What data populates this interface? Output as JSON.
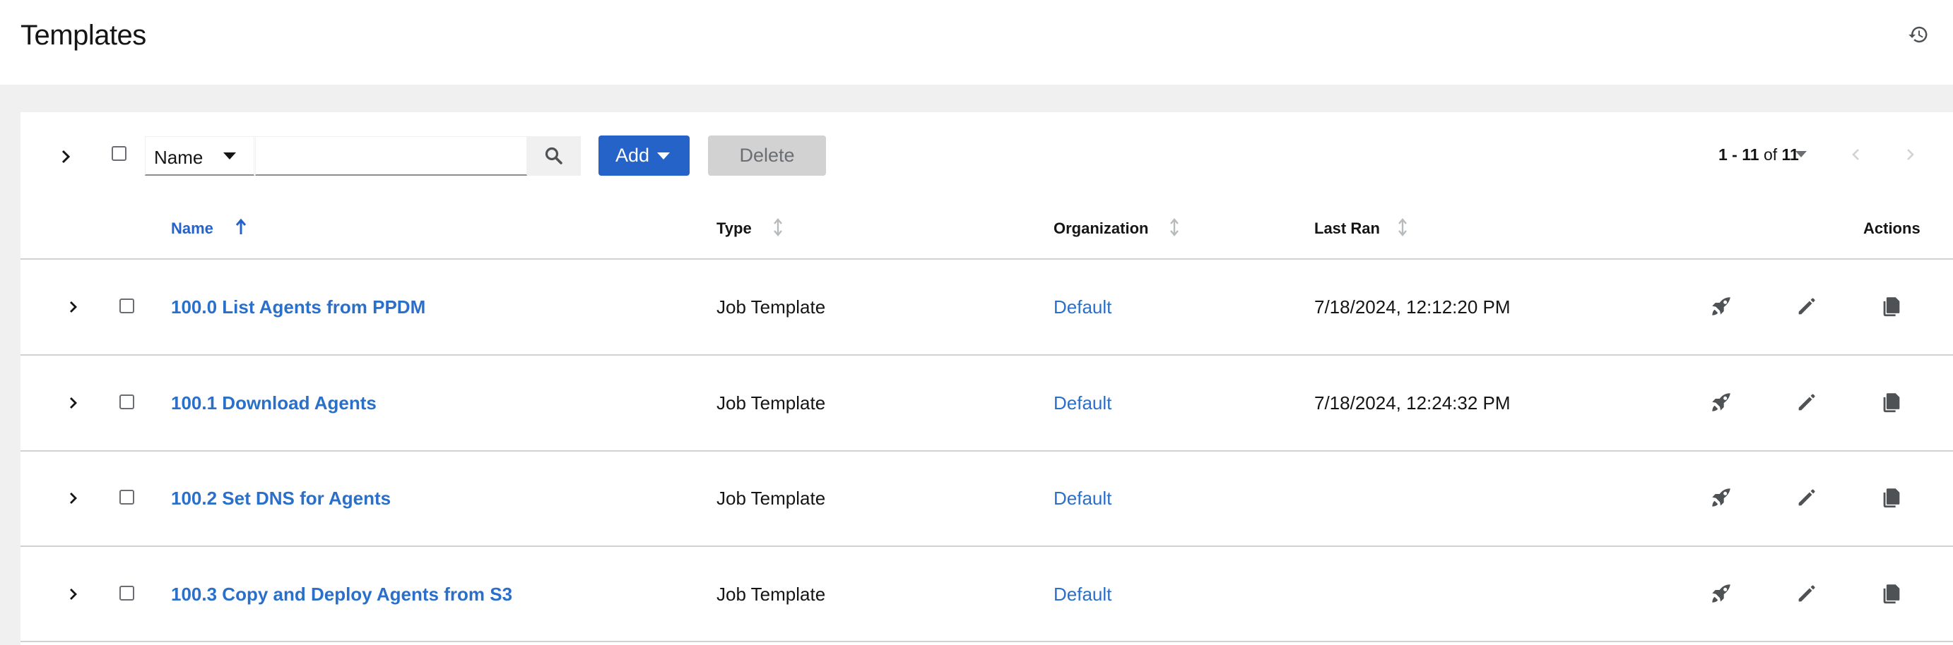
{
  "header": {
    "title": "Templates",
    "history_icon": "history-icon"
  },
  "toolbar": {
    "filter_field": "Name",
    "search_value": "",
    "add_label": "Add",
    "delete_label": "Delete",
    "pagination": {
      "range": "1 - 11",
      "of_word": "of",
      "total": "11"
    }
  },
  "table": {
    "columns": {
      "name": "Name",
      "type": "Type",
      "organization": "Organization",
      "last_ran": "Last Ran",
      "actions": "Actions"
    },
    "sorted_column": "name",
    "rows": [
      {
        "name": "100.0 List Agents from PPDM",
        "type": "Job Template",
        "organization": "Default",
        "last_ran": "7/18/2024, 12:12:20 PM"
      },
      {
        "name": "100.1 Download Agents",
        "type": "Job Template",
        "organization": "Default",
        "last_ran": "7/18/2024, 12:24:32 PM"
      },
      {
        "name": "100.2 Set DNS for Agents",
        "type": "Job Template",
        "organization": "Default",
        "last_ran": ""
      },
      {
        "name": "100.3 Copy and Deploy Agents from S3",
        "type": "Job Template",
        "organization": "Default",
        "last_ran": ""
      }
    ],
    "row_action_icons": [
      "rocket-icon",
      "pencil-icon",
      "copy-icon"
    ]
  },
  "colors": {
    "accent": "#2563c9",
    "link": "#2a6fc9",
    "disabled": "#d2d2d2",
    "background": "#f0f0f0"
  }
}
